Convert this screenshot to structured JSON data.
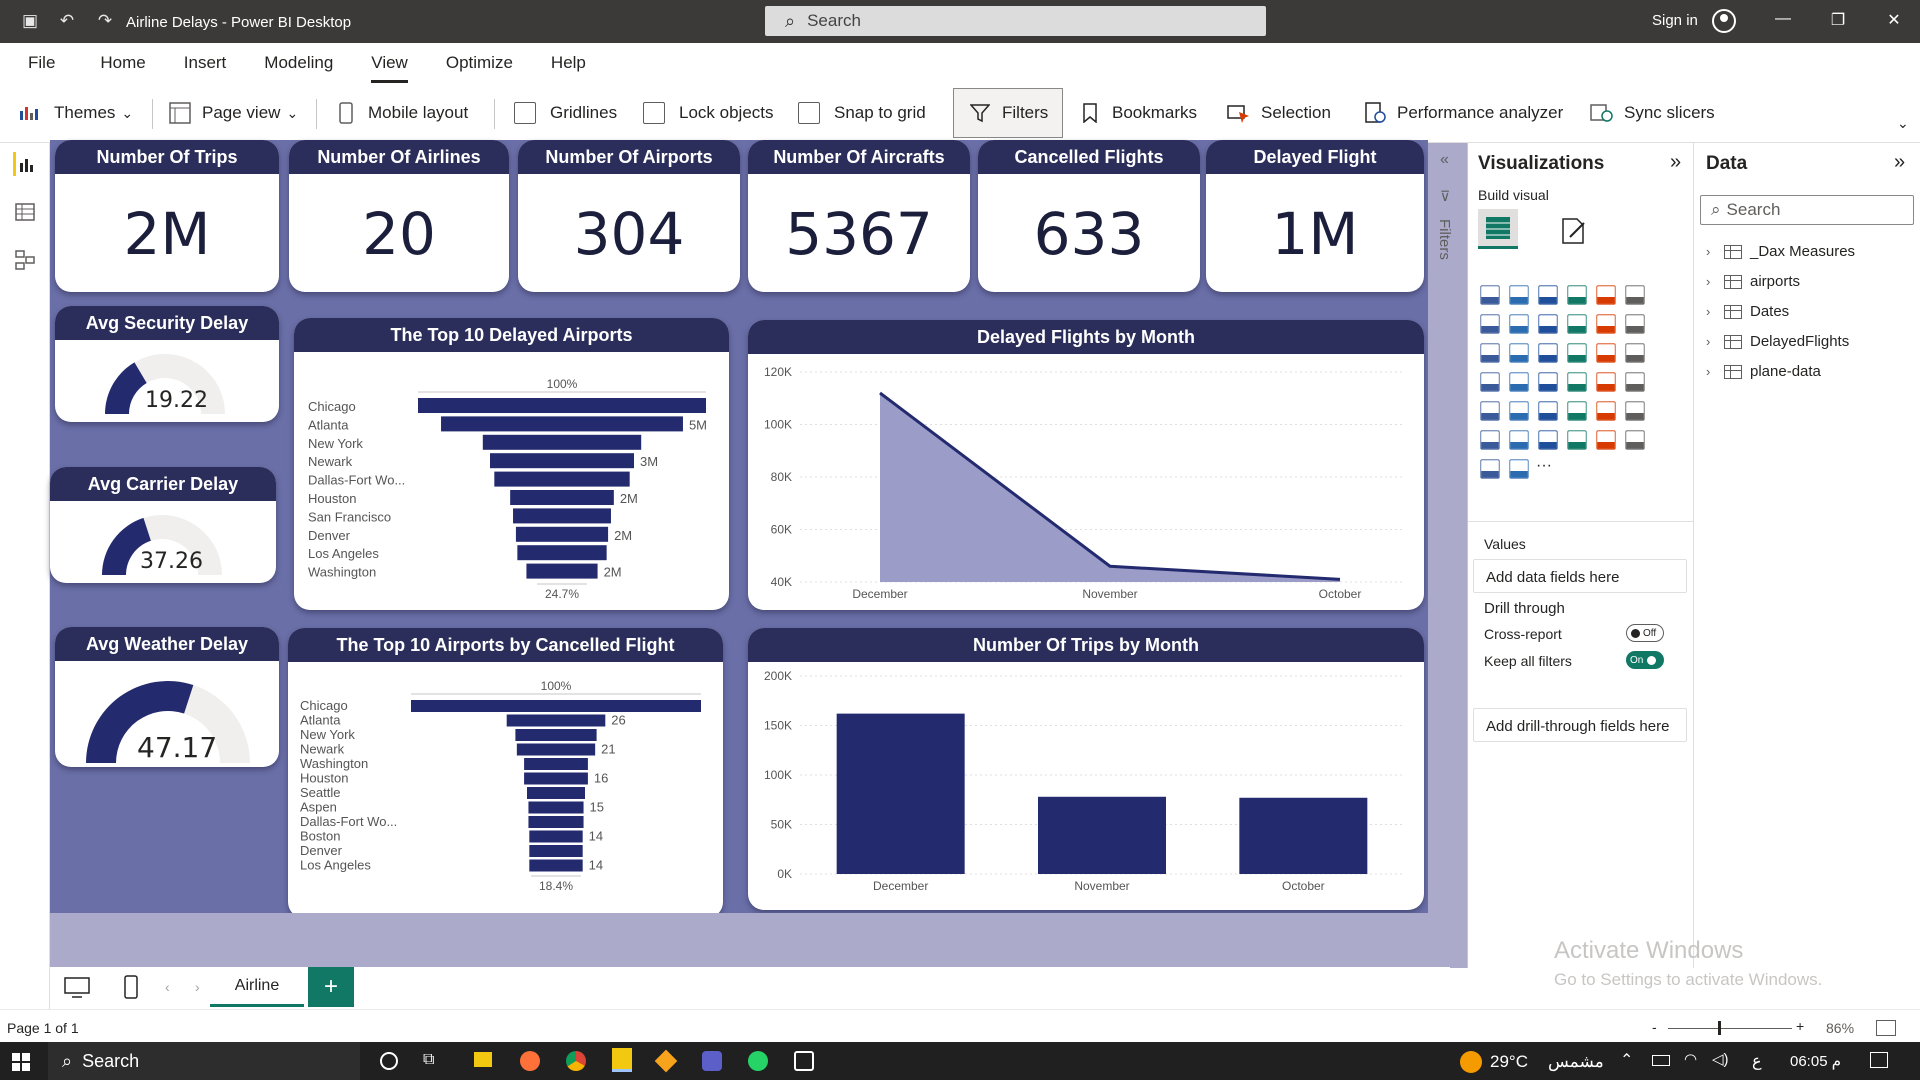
{
  "titlebar": {
    "title": "Airline Delays - Power BI Desktop",
    "search_placeholder": "Search",
    "signin": "Sign in"
  },
  "menu": [
    "File",
    "Home",
    "Insert",
    "Modeling",
    "View",
    "Optimize",
    "Help"
  ],
  "ribbon": {
    "themes": "Themes",
    "page_view": "Page view",
    "mobile_layout": "Mobile layout",
    "gridlines": "Gridlines",
    "lock_objects": "Lock objects",
    "snap_to_grid": "Snap to grid",
    "filters": "Filters",
    "bookmarks": "Bookmarks",
    "selection": "Selection",
    "performance_analyzer": "Performance analyzer",
    "sync_slicers": "Sync slicers"
  },
  "kpis": [
    {
      "title": "Number Of Trips",
      "value": "2M"
    },
    {
      "title": "Number Of Airlines",
      "value": "20"
    },
    {
      "title": "Number Of Airports",
      "value": "304"
    },
    {
      "title": "Number Of Aircrafts",
      "value": "5367"
    },
    {
      "title": "Cancelled Flights",
      "value": "633"
    },
    {
      "title": "Delayed Flight",
      "value": "1M"
    }
  ],
  "gauges": [
    {
      "title": "Avg Security Delay",
      "value": "19.22",
      "fill": 0.33
    },
    {
      "title": "Avg Carrier Delay",
      "value": "37.26",
      "fill": 0.4
    },
    {
      "title": "Avg Weather Delay",
      "value": "47.17",
      "fill": 0.6
    }
  ],
  "chart_data": [
    {
      "type": "bar",
      "title": "The Top 10 Delayed Airports",
      "top_label": "100%",
      "bottom_label": "24.7%",
      "categories": [
        "Chicago",
        "Atlanta",
        "New York",
        "Newark",
        "Dallas-Fort Wo...",
        "Houston",
        "San Francisco",
        "Denver",
        "Los Angeles",
        "Washington"
      ],
      "values": [
        100,
        84,
        55,
        50,
        47,
        36,
        34,
        32,
        31,
        24.7
      ],
      "data_labels": [
        "",
        "5M",
        "",
        "3M",
        "",
        "2M",
        "",
        "2M",
        "",
        "2M"
      ]
    },
    {
      "type": "area",
      "title": "Delayed Flights by Month",
      "categories": [
        "December",
        "November",
        "October"
      ],
      "values": [
        112000,
        46000,
        41000
      ],
      "ylim": [
        40000,
        120000
      ],
      "yticks": [
        "120K",
        "100K",
        "80K",
        "60K",
        "40K"
      ]
    },
    {
      "type": "bar",
      "title": "The Top 10 Airports by Cancelled Flight",
      "top_label": "100%",
      "bottom_label": "18.4%",
      "categories": [
        "Chicago",
        "Atlanta",
        "New York",
        "Newark",
        "Washington",
        "Houston",
        "Seattle",
        "Aspen",
        "Dallas-Fort Wo...",
        "Boston",
        "Denver",
        "Los Angeles"
      ],
      "values": [
        100,
        34,
        28,
        27,
        22,
        22,
        20,
        19,
        19,
        18.4,
        18.4,
        18.4
      ],
      "data_labels": [
        "",
        "26",
        "",
        "21",
        "",
        "16",
        "",
        "15",
        "",
        "14",
        "",
        "14"
      ]
    },
    {
      "type": "bar",
      "title": "Number Of Trips by Month",
      "categories": [
        "December",
        "November",
        "October"
      ],
      "values": [
        162000,
        78000,
        77000
      ],
      "ylim": [
        0,
        200000
      ],
      "yticks": [
        "200K",
        "150K",
        "100K",
        "50K",
        "0K"
      ]
    }
  ],
  "viz_pane": {
    "title": "Visualizations",
    "build": "Build visual",
    "values": "Values",
    "add_fields": "Add data fields here",
    "drill": "Drill through",
    "cross": "Cross-report",
    "cross_state": "Off",
    "keep": "Keep all filters",
    "keep_state": "On",
    "add_drill": "Add drill-through fields here"
  },
  "data_pane": {
    "title": "Data",
    "search": "Search",
    "tables": [
      "_Dax Measures",
      "airports",
      "Dates",
      "DelayedFlights",
      "plane-data"
    ]
  },
  "filters_label": "Filters",
  "tabs": {
    "page": "Airline",
    "add": "+"
  },
  "status": {
    "page": "Page 1 of 1",
    "zoom": "86%"
  },
  "watermark": {
    "line1": "Activate Windows",
    "line2": "Go to Settings to activate Windows."
  },
  "taskbar": {
    "search": "Search",
    "temp": "29°C",
    "weather": "مشمس",
    "lang": "ع",
    "time": "06:05 م"
  },
  "colors": {
    "navy": "#2b2e5a",
    "bar": "#232a6e",
    "canvas": "#6a6fa8",
    "accent": "#117865"
  }
}
